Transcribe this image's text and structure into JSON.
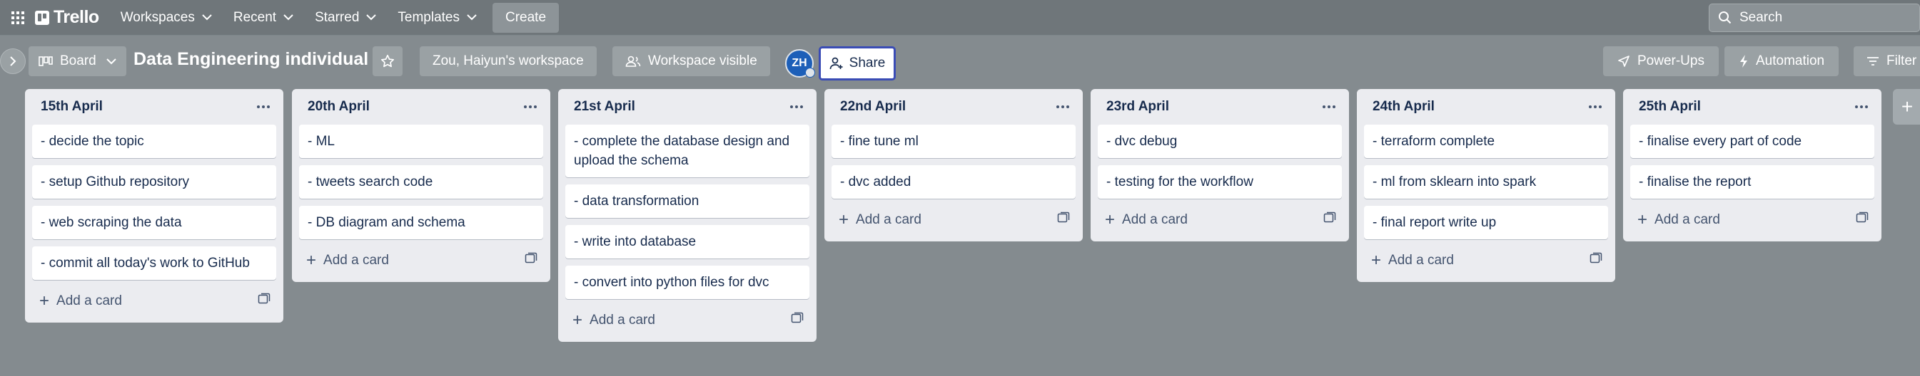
{
  "topnav": {
    "logo": "Trello",
    "menu": [
      {
        "label": "Workspaces"
      },
      {
        "label": "Recent"
      },
      {
        "label": "Starred"
      },
      {
        "label": "Templates"
      }
    ],
    "create_label": "Create",
    "search_placeholder": "Search"
  },
  "board": {
    "view_label": "Board",
    "title": "Data Engineering individual",
    "workspace_label": "Zou, Haiyun's workspace",
    "visibility_label": "Workspace visible",
    "avatar_initials": "ZH",
    "share_label": "Share",
    "powerups_label": "Power-Ups",
    "automation_label": "Automation",
    "filter_label": "Filter"
  },
  "add_card_label": "Add a card",
  "lists": [
    {
      "title": "15th April",
      "cards": [
        "- decide the topic",
        "- setup Github repository",
        "- web scraping the data",
        "- commit all today's work to GitHub"
      ]
    },
    {
      "title": "20th April",
      "cards": [
        "- ML",
        "- tweets search code",
        "- DB diagram and schema"
      ]
    },
    {
      "title": "21st April",
      "cards": [
        "- complete the database design and upload the schema",
        "- data transformation",
        "- write into database",
        "- convert into python files for dvc"
      ]
    },
    {
      "title": "22nd April",
      "cards": [
        "- fine tune ml",
        "- dvc added"
      ]
    },
    {
      "title": "23rd April",
      "cards": [
        "- dvc debug",
        "- testing for the workflow"
      ]
    },
    {
      "title": "24th April",
      "cards": [
        "- terraform complete",
        "- ml from sklearn into spark",
        "- final report write up"
      ]
    },
    {
      "title": "25th April",
      "cards": [
        "- finalise every part of code",
        "- finalise the report"
      ]
    }
  ],
  "add_list_symbol": "+"
}
